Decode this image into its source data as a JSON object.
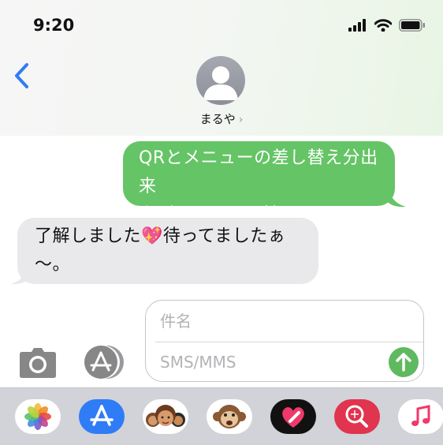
{
  "status_bar": {
    "time": "9:20"
  },
  "header": {
    "contact_name": "まるや",
    "contact_chevron": "›"
  },
  "messages": [
    {
      "direction": "sent",
      "lines": [
        "QRとメニューの差し替え分出来",
        "上がったのでお持ちします!!"
      ]
    },
    {
      "direction": "received",
      "lines": [
        "了解しました💖待ってましたぁ",
        "〜。"
      ]
    }
  ],
  "composer": {
    "subject_placeholder": "件名",
    "body_placeholder": "SMS/MMS"
  },
  "colors": {
    "sent_bubble": "#65c466",
    "received_bubble": "#e9e9eb",
    "ios_blue": "#2f7cf6",
    "send_button": "#5fb95f"
  },
  "app_tray": {
    "apps": [
      "photos-icon",
      "app-store-icon",
      "memoji-icon",
      "monkey-animoji-icon",
      "digital-touch-icon",
      "image-search-icon",
      "music-icon"
    ]
  }
}
